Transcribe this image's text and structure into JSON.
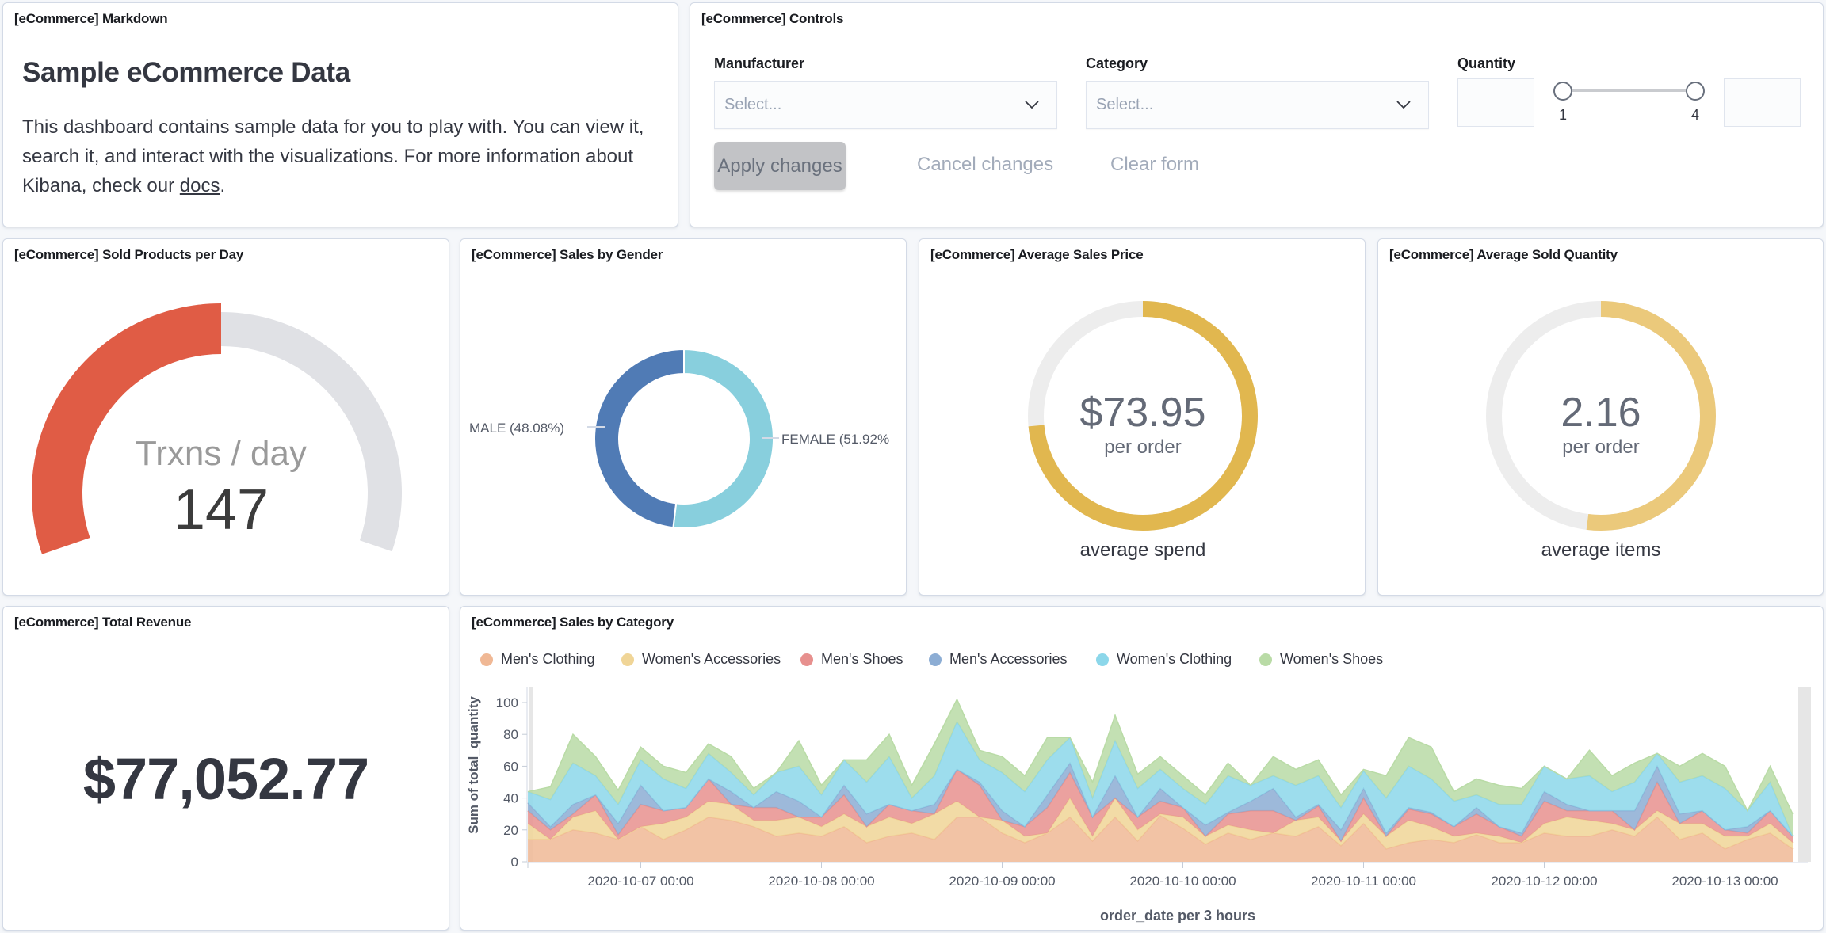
{
  "markdown_panel": {
    "title": "[eCommerce] Markdown",
    "heading": "Sample eCommerce Data",
    "body_text": "This dashboard contains sample data for you to play with. You can view it, search it, and interact with the visualizations. For more information about Kibana, check our ",
    "link_text": "docs",
    "trailing": "."
  },
  "controls_panel": {
    "title": "[eCommerce] Controls",
    "manufacturer": {
      "label": "Manufacturer",
      "placeholder": "Select..."
    },
    "category": {
      "label": "Category",
      "placeholder": "Select..."
    },
    "quantity": {
      "label": "Quantity",
      "min_value": "",
      "max_value": "",
      "range_min": "1",
      "range_max": "4"
    },
    "apply_label": "Apply changes",
    "cancel_label": "Cancel changes",
    "clear_label": "Clear form"
  },
  "sold_products_panel": {
    "title": "[eCommerce] Sold Products per Day",
    "label": "Trxns / day",
    "value": "147",
    "fill_fraction": 0.5,
    "colors": {
      "fill": "#e05c45",
      "track": "#e0e1e5"
    }
  },
  "gender_panel": {
    "title": "[eCommerce] Sales by Gender",
    "colors": {
      "male": "#507bb5",
      "female": "#88cfdd"
    }
  },
  "avg_price_panel": {
    "title": "[eCommerce] Average Sales Price",
    "value": "$73.95",
    "unit": "per order",
    "caption": "average spend",
    "fill_fraction": 0.735,
    "colors": {
      "fill": "#e1b74f",
      "track": "#ededed"
    }
  },
  "avg_qty_panel": {
    "title": "[eCommerce] Average Sold Quantity",
    "value": "2.16",
    "unit": "per order",
    "caption": "average items",
    "fill_fraction": 0.52,
    "colors": {
      "fill": "#ebc97b",
      "track": "#ededed"
    }
  },
  "revenue_panel": {
    "title": "[eCommerce] Total Revenue",
    "value": "$77,052.77"
  },
  "category_panel": {
    "title": "[eCommerce] Sales by Category"
  },
  "chart_data": [
    {
      "type": "pie",
      "title": "[eCommerce] Sales by Gender",
      "donut": true,
      "slices": [
        {
          "label": "FEMALE",
          "percent": 51.92,
          "display": "FEMALE (51.92%"
        },
        {
          "label": "MALE",
          "percent": 48.08,
          "display": "MALE (48.08%)"
        }
      ]
    },
    {
      "type": "area",
      "stacked": true,
      "title": "[eCommerce] Sales by Category",
      "xlabel": "order_date per 3 hours",
      "ylabel": "Sum of total_quantity",
      "ylim": [
        0,
        100
      ],
      "yticks": [
        0,
        20,
        40,
        60,
        80,
        100
      ],
      "x_start": "2020-10-06 09:00",
      "x_step_hours": 3,
      "x_count": 57,
      "xticks": [
        {
          "label": "2020-10-07 00:00",
          "index": 5
        },
        {
          "label": "2020-10-08 00:00",
          "index": 13
        },
        {
          "label": "2020-10-09 00:00",
          "index": 21
        },
        {
          "label": "2020-10-10 00:00",
          "index": 29
        },
        {
          "label": "2020-10-11 00:00",
          "index": 37
        },
        {
          "label": "2020-10-12 00:00",
          "index": 45
        },
        {
          "label": "2020-10-13 00:00",
          "index": 53
        }
      ],
      "legend_position": "top-left",
      "grid": false,
      "series": [
        {
          "name": "Men's Clothing",
          "color": "#f0b895",
          "values": [
            14,
            14,
            20,
            18,
            14,
            22,
            14,
            20,
            28,
            26,
            22,
            16,
            18,
            16,
            22,
            12,
            16,
            18,
            14,
            28,
            28,
            18,
            12,
            18,
            28,
            13,
            28,
            13,
            29,
            21,
            11,
            18,
            14,
            18,
            16,
            22,
            10,
            24,
            8,
            12,
            14,
            12,
            17,
            12,
            12,
            18,
            16,
            16,
            20,
            16,
            28,
            14,
            18,
            8,
            14,
            18,
            8
          ]
        },
        {
          "name": "Women's Accessories",
          "color": "#f0d597",
          "values": [
            10,
            0,
            8,
            14,
            0,
            0,
            10,
            8,
            10,
            10,
            4,
            10,
            10,
            6,
            8,
            10,
            12,
            6,
            16,
            10,
            0,
            8,
            4,
            0,
            12,
            3,
            12,
            7,
            1,
            7,
            5,
            5,
            6,
            0,
            10,
            6,
            3,
            6,
            8,
            14,
            8,
            4,
            1,
            4,
            0,
            6,
            12,
            10,
            4,
            4,
            4,
            10,
            6,
            8,
            2,
            6,
            4
          ]
        },
        {
          "name": "Men's Shoes",
          "color": "#e7908e",
          "values": [
            8,
            6,
            2,
            10,
            3,
            14,
            8,
            6,
            14,
            0,
            8,
            8,
            0,
            6,
            12,
            0,
            8,
            8,
            0,
            20,
            20,
            0,
            6,
            16,
            16,
            12,
            0,
            8,
            8,
            6,
            0,
            7,
            12,
            14,
            0,
            7,
            0,
            10,
            0,
            7,
            8,
            6,
            12,
            6,
            4,
            14,
            4,
            6,
            8,
            0,
            18,
            0,
            8,
            4,
            2,
            8,
            4
          ]
        },
        {
          "name": "Men's Accessories",
          "color": "#8cadd4",
          "values": [
            5,
            2,
            6,
            0,
            7,
            12,
            0,
            0,
            0,
            8,
            0,
            10,
            10,
            0,
            6,
            8,
            0,
            0,
            6,
            0,
            2,
            6,
            0,
            8,
            6,
            0,
            14,
            0,
            8,
            0,
            7,
            1,
            6,
            14,
            2,
            1,
            7,
            6,
            2,
            1,
            1,
            0,
            4,
            0,
            2,
            6,
            4,
            0,
            0,
            12,
            10,
            6,
            0,
            0,
            4,
            0,
            0
          ]
        },
        {
          "name": "Women's Clothing",
          "color": "#8cd7ea",
          "values": [
            7,
            17,
            26,
            12,
            12,
            16,
            20,
            12,
            16,
            12,
            8,
            12,
            22,
            14,
            16,
            20,
            30,
            8,
            18,
            30,
            14,
            24,
            22,
            22,
            16,
            12,
            22,
            18,
            12,
            12,
            13,
            23,
            10,
            8,
            20,
            18,
            14,
            11,
            22,
            26,
            21,
            16,
            8,
            14,
            18,
            16,
            16,
            22,
            12,
            18,
            8,
            20,
            22,
            26,
            10,
            18,
            0
          ]
        },
        {
          "name": "Women's Shoes",
          "color": "#b9dba6",
          "values": [
            0,
            8,
            18,
            12,
            9,
            8,
            8,
            10,
            6,
            10,
            4,
            0,
            16,
            6,
            0,
            14,
            14,
            8,
            20,
            14,
            6,
            10,
            10,
            14,
            0,
            10,
            16,
            9,
            8,
            8,
            6,
            8,
            0,
            12,
            10,
            10,
            8,
            1,
            14,
            18,
            20,
            6,
            10,
            12,
            10,
            0,
            0,
            16,
            10,
            12,
            0,
            10,
            14,
            14,
            0,
            10,
            14
          ]
        }
      ]
    }
  ]
}
